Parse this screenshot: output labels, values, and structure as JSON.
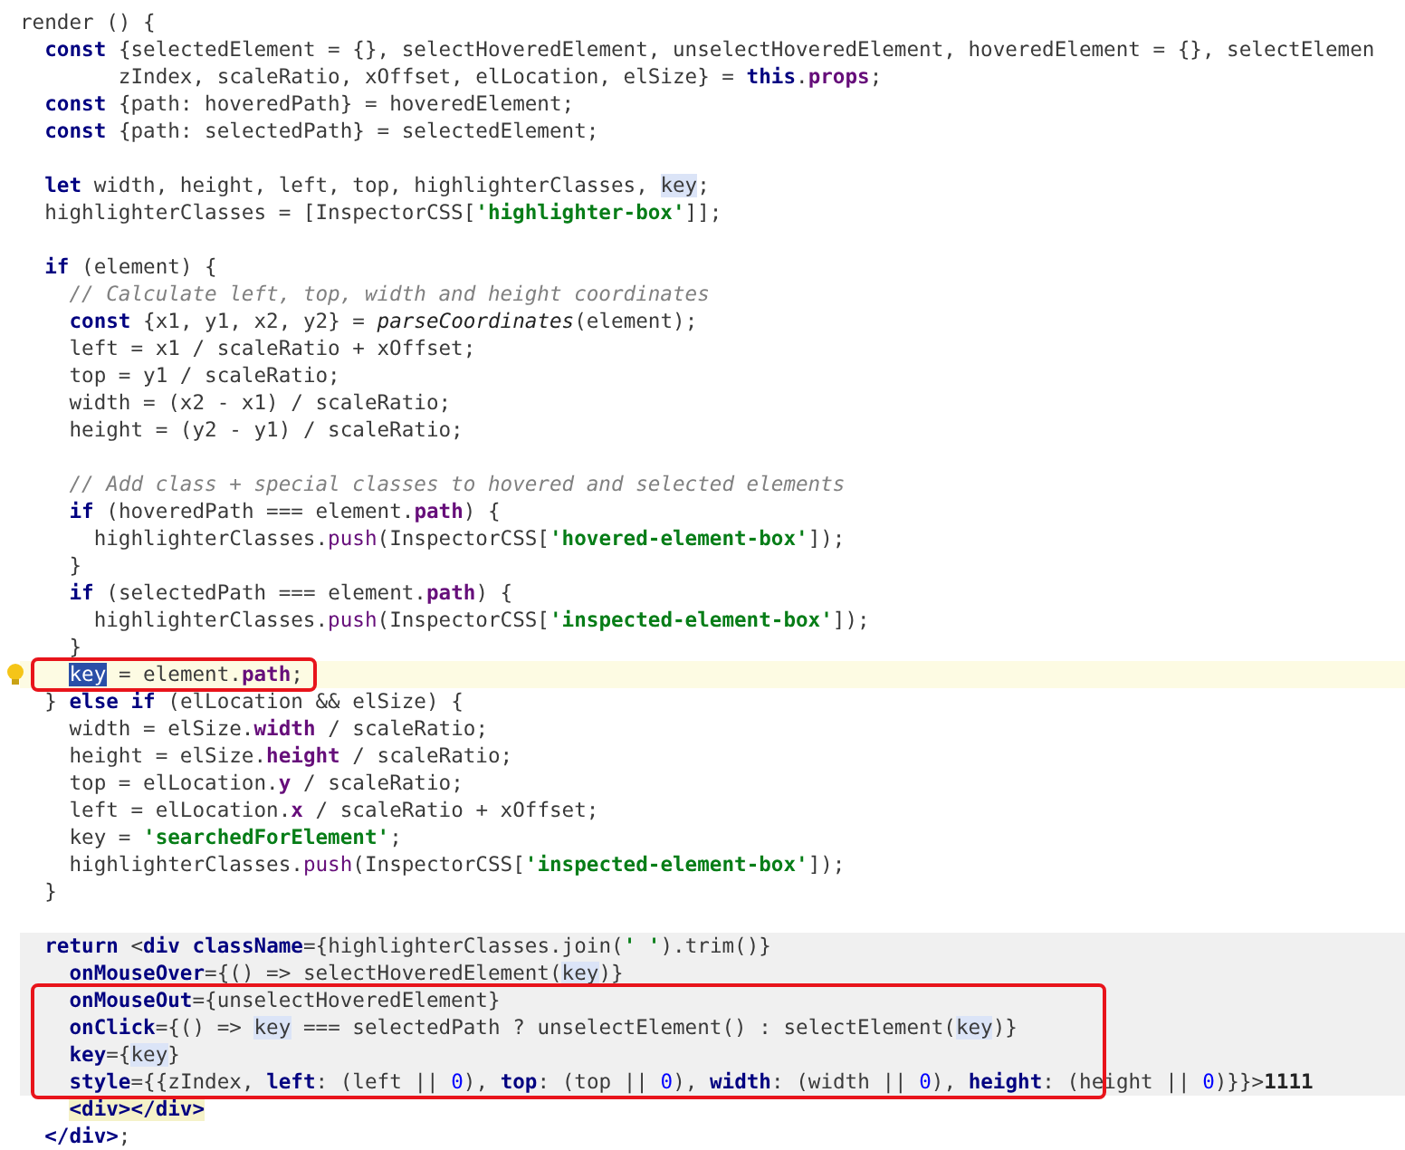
{
  "lines": [
    {
      "kind": "code",
      "tokens": [
        {
          "kind": "plain",
          "text": "render () {"
        }
      ]
    },
    {
      "kind": "code",
      "tokens": [
        {
          "kind": "kw",
          "text": "  const"
        },
        {
          "kind": "plain",
          "text": " {selectedElement = {}, selectHoveredElement, unselectHoveredElement, hoveredElement = {}, selectElemen"
        }
      ]
    },
    {
      "kind": "code",
      "tokens": [
        {
          "kind": "plain",
          "text": "        zIndex, scaleRatio, xOffset, elLocation, elSize} = "
        },
        {
          "kind": "kw",
          "text": "this"
        },
        {
          "kind": "plain",
          "text": "."
        },
        {
          "kind": "prop",
          "text": "props"
        },
        {
          "kind": "plain",
          "text": ";"
        }
      ]
    },
    {
      "kind": "code",
      "tokens": [
        {
          "kind": "kw",
          "text": "  const"
        },
        {
          "kind": "plain",
          "text": " {path: hoveredPath} = hoveredElement;"
        }
      ]
    },
    {
      "kind": "code",
      "tokens": [
        {
          "kind": "kw",
          "text": "  const"
        },
        {
          "kind": "plain",
          "text": " {path: selectedPath} = selectedElement;"
        }
      ]
    },
    {
      "kind": "blank"
    },
    {
      "kind": "code",
      "tokens": [
        {
          "kind": "kw",
          "text": "  let"
        },
        {
          "kind": "plain",
          "text": " width, height, left, top, highlighterClasses, "
        },
        {
          "kind": "ref",
          "text": "key"
        },
        {
          "kind": "plain",
          "text": ";"
        }
      ]
    },
    {
      "kind": "code",
      "tokens": [
        {
          "kind": "plain",
          "text": "  highlighterClasses = [InspectorCSS["
        },
        {
          "kind": "str",
          "text": "'highlighter-box'"
        },
        {
          "kind": "plain",
          "text": "]];"
        }
      ]
    },
    {
      "kind": "blank"
    },
    {
      "kind": "code",
      "tokens": [
        {
          "kind": "kw",
          "text": "  if"
        },
        {
          "kind": "plain",
          "text": " (element) {"
        }
      ]
    },
    {
      "kind": "code",
      "tokens": [
        {
          "kind": "comment",
          "text": "    // Calculate left, top, width and height coordinates"
        }
      ]
    },
    {
      "kind": "code",
      "tokens": [
        {
          "kind": "kw",
          "text": "    const"
        },
        {
          "kind": "plain",
          "text": " {x1, y1, x2, y2} = "
        },
        {
          "kind": "fn",
          "text": "parseCoordinates"
        },
        {
          "kind": "plain",
          "text": "(element);"
        }
      ]
    },
    {
      "kind": "code",
      "tokens": [
        {
          "kind": "plain",
          "text": "    left = x1 / scaleRatio + xOffset;"
        }
      ]
    },
    {
      "kind": "code",
      "tokens": [
        {
          "kind": "plain",
          "text": "    top = y1 / scaleRatio;"
        }
      ]
    },
    {
      "kind": "code",
      "tokens": [
        {
          "kind": "plain",
          "text": "    width = (x2 - x1) / scaleRatio;"
        }
      ]
    },
    {
      "kind": "code",
      "tokens": [
        {
          "kind": "plain",
          "text": "    height = (y2 - y1) / scaleRatio;"
        }
      ]
    },
    {
      "kind": "blank"
    },
    {
      "kind": "code",
      "tokens": [
        {
          "kind": "comment",
          "text": "    // Add class + special classes to hovered and selected elements"
        }
      ]
    },
    {
      "kind": "code",
      "tokens": [
        {
          "kind": "kw",
          "text": "    if"
        },
        {
          "kind": "plain",
          "text": " (hoveredPath === element."
        },
        {
          "kind": "prop",
          "text": "path"
        },
        {
          "kind": "plain",
          "text": ") {"
        }
      ]
    },
    {
      "kind": "code",
      "tokens": [
        {
          "kind": "plain",
          "text": "      highlighterClasses."
        },
        {
          "kind": "method",
          "text": "push"
        },
        {
          "kind": "plain",
          "text": "(InspectorCSS["
        },
        {
          "kind": "str",
          "text": "'hovered-element-box'"
        },
        {
          "kind": "plain",
          "text": "]);"
        }
      ]
    },
    {
      "kind": "code",
      "tokens": [
        {
          "kind": "plain",
          "text": "    }"
        }
      ]
    },
    {
      "kind": "code",
      "tokens": [
        {
          "kind": "kw",
          "text": "    if"
        },
        {
          "kind": "plain",
          "text": " (selectedPath === element."
        },
        {
          "kind": "prop",
          "text": "path"
        },
        {
          "kind": "plain",
          "text": ") {"
        }
      ]
    },
    {
      "kind": "code",
      "tokens": [
        {
          "kind": "plain",
          "text": "      highlighterClasses."
        },
        {
          "kind": "method",
          "text": "push"
        },
        {
          "kind": "plain",
          "text": "(InspectorCSS["
        },
        {
          "kind": "str",
          "text": "'inspected-element-box'"
        },
        {
          "kind": "plain",
          "text": "]);"
        }
      ]
    },
    {
      "kind": "code",
      "tokens": [
        {
          "kind": "plain",
          "text": "    }"
        }
      ]
    },
    {
      "kind": "code",
      "current": true,
      "bulb": true,
      "boxed": true,
      "tokens": [
        {
          "kind": "sel",
          "text": "    key"
        },
        {
          "kind": "plain",
          "text": " = element."
        },
        {
          "kind": "prop",
          "text": "path"
        },
        {
          "kind": "plain",
          "text": ";"
        }
      ]
    },
    {
      "kind": "code",
      "tokens": [
        {
          "kind": "plain",
          "text": "  } "
        },
        {
          "kind": "kw",
          "text": "else if"
        },
        {
          "kind": "plain",
          "text": " (elLocation && elSize) {"
        }
      ]
    },
    {
      "kind": "code",
      "tokens": [
        {
          "kind": "plain",
          "text": "    width = elSize."
        },
        {
          "kind": "prop",
          "text": "width"
        },
        {
          "kind": "plain",
          "text": " / scaleRatio;"
        }
      ]
    },
    {
      "kind": "code",
      "tokens": [
        {
          "kind": "plain",
          "text": "    height = elSize."
        },
        {
          "kind": "prop",
          "text": "height"
        },
        {
          "kind": "plain",
          "text": " / scaleRatio;"
        }
      ]
    },
    {
      "kind": "code",
      "tokens": [
        {
          "kind": "plain",
          "text": "    top = elLocation."
        },
        {
          "kind": "prop",
          "text": "y"
        },
        {
          "kind": "plain",
          "text": " / scaleRatio;"
        }
      ]
    },
    {
      "kind": "code",
      "tokens": [
        {
          "kind": "plain",
          "text": "    left = elLocation."
        },
        {
          "kind": "prop",
          "text": "x"
        },
        {
          "kind": "plain",
          "text": " / scaleRatio + xOffset;"
        }
      ]
    },
    {
      "kind": "code",
      "tokens": [
        {
          "kind": "plain",
          "text": "    key = "
        },
        {
          "kind": "str",
          "text": "'searchedForElement'"
        },
        {
          "kind": "plain",
          "text": ";"
        }
      ]
    },
    {
      "kind": "code",
      "tokens": [
        {
          "kind": "plain",
          "text": "    highlighterClasses."
        },
        {
          "kind": "method",
          "text": "push"
        },
        {
          "kind": "plain",
          "text": "(InspectorCSS["
        },
        {
          "kind": "str",
          "text": "'inspected-element-box'"
        },
        {
          "kind": "plain",
          "text": "]);"
        }
      ]
    },
    {
      "kind": "code",
      "tokens": [
        {
          "kind": "plain",
          "text": "  }"
        }
      ]
    },
    {
      "kind": "blank"
    },
    {
      "kind": "code",
      "shaded": true,
      "tokens": [
        {
          "kind": "kw",
          "text": "  return"
        },
        {
          "kind": "plain",
          "text": " <"
        },
        {
          "kind": "kw",
          "text": "div"
        },
        {
          "kind": "attr",
          "text": " className"
        },
        {
          "kind": "plain",
          "text": "={highlighterClasses.join("
        },
        {
          "kind": "str",
          "text": "' '"
        },
        {
          "kind": "plain",
          "text": ").trim()}"
        }
      ]
    },
    {
      "kind": "code",
      "shaded": true,
      "tokens": [
        {
          "kind": "attr",
          "text": "    onMouseOver"
        },
        {
          "kind": "plain",
          "text": "={() => selectHoveredElement("
        },
        {
          "kind": "ref",
          "text": "key"
        },
        {
          "kind": "plain",
          "text": ")}"
        }
      ]
    },
    {
      "kind": "code",
      "shaded": true,
      "boxed": true,
      "tokens": [
        {
          "kind": "attr",
          "text": "    onMouseOut"
        },
        {
          "kind": "plain",
          "text": "={unselectHoveredElement}"
        }
      ]
    },
    {
      "kind": "code",
      "shaded": true,
      "boxed": true,
      "tokens": [
        {
          "kind": "attr",
          "text": "    onClick"
        },
        {
          "kind": "plain",
          "text": "={() => "
        },
        {
          "kind": "ref",
          "text": "key"
        },
        {
          "kind": "plain",
          "text": " === selectedPath ? unselectElement() : selectElement("
        },
        {
          "kind": "ref",
          "text": "key"
        },
        {
          "kind": "plain",
          "text": ")}"
        }
      ]
    },
    {
      "kind": "code",
      "shaded": true,
      "boxed": true,
      "tokens": [
        {
          "kind": "attr",
          "text": "    key"
        },
        {
          "kind": "plain",
          "text": "={"
        },
        {
          "kind": "ref",
          "text": "key"
        },
        {
          "kind": "plain",
          "text": "}"
        }
      ]
    },
    {
      "kind": "code",
      "shaded": true,
      "boxed": true,
      "tokens": [
        {
          "kind": "attr",
          "text": "    style"
        },
        {
          "kind": "plain",
          "text": "={{zIndex, "
        },
        {
          "kind": "attr",
          "text": "left"
        },
        {
          "kind": "plain",
          "text": ": (left || "
        },
        {
          "kind": "num",
          "text": "0"
        },
        {
          "kind": "plain",
          "text": "), "
        },
        {
          "kind": "attr",
          "text": "top"
        },
        {
          "kind": "plain",
          "text": ": (top || "
        },
        {
          "kind": "num",
          "text": "0"
        },
        {
          "kind": "plain",
          "text": "), "
        },
        {
          "kind": "attr",
          "text": "width"
        },
        {
          "kind": "plain",
          "text": ": (width || "
        },
        {
          "kind": "num",
          "text": "0"
        },
        {
          "kind": "plain",
          "text": "), "
        },
        {
          "kind": "attr",
          "text": "height"
        },
        {
          "kind": "plain",
          "text": ": (height || "
        },
        {
          "kind": "num",
          "text": "0"
        },
        {
          "kind": "plain",
          "text": ")}}>"
        },
        {
          "kind": "jsxtext",
          "text": "1111"
        }
      ]
    },
    {
      "kind": "code",
      "tokens": [
        {
          "kind": "tag",
          "text": "    <div></div>"
        }
      ]
    },
    {
      "kind": "code",
      "tokens": [
        {
          "kind": "kw",
          "text": "  </div>"
        },
        {
          "kind": "plain",
          "text": ";"
        }
      ]
    }
  ]
}
